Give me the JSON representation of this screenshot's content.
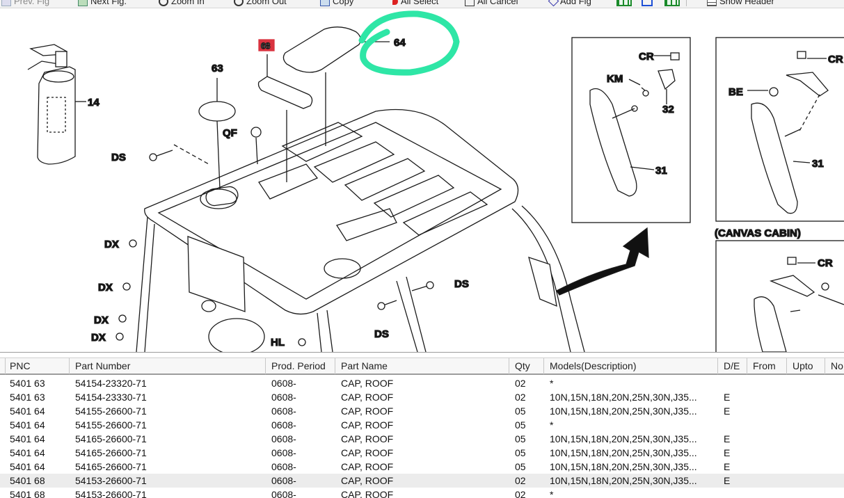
{
  "toolbar": {
    "buttons": [
      {
        "label": "Prev. Fig",
        "icon": "prev-fig-icon"
      },
      {
        "label": "Next Fig.",
        "icon": "next-fig-icon"
      },
      {
        "label": "Zoom In",
        "icon": "zoom-in-icon"
      },
      {
        "label": "Zoom Out",
        "icon": "zoom-out-icon"
      },
      {
        "label": "Copy",
        "icon": "copy-icon"
      },
      {
        "label": "All Select",
        "icon": "all-select-icon"
      },
      {
        "label": "All Cancel",
        "icon": "all-cancel-icon"
      },
      {
        "label": "Add Fig",
        "icon": "add-fig-icon"
      },
      {
        "label": "Show Header",
        "icon": "show-header-icon"
      }
    ]
  },
  "drawing": {
    "callouts": {
      "c14": "14",
      "c63": "63",
      "c68": "68",
      "c64": "64",
      "qf": "QF",
      "ds1": "DS",
      "ds2": "DS",
      "ds3": "DS",
      "dx1": "DX",
      "dx2": "DX",
      "dx3": "DX",
      "dx4": "DX",
      "hl": "HL",
      "cr1": "CR",
      "km": "KM",
      "c32": "32",
      "c31a": "31",
      "cr2": "CR",
      "be": "BE",
      "c31b": "31",
      "cr3": "CR"
    },
    "canvas_cabin_label": "(CANVAS CABIN)",
    "highlight_color": "#2ee6a6",
    "selected_callout_color": "#d9333f"
  },
  "grid": {
    "columns": [
      "PNC",
      "Part Number",
      "Prod. Period",
      "Part Name",
      "Qty",
      "Models(Description)",
      "D/E",
      "From",
      "Upto",
      "No"
    ],
    "rows": [
      {
        "pnc": "5401 63",
        "part_number": "54154-23320-71",
        "period": "0608-",
        "name": "CAP, ROOF",
        "qty": "02",
        "models": "*",
        "de": ""
      },
      {
        "pnc": "5401 63",
        "part_number": "54154-23330-71",
        "period": "0608-",
        "name": "CAP, ROOF",
        "qty": "02",
        "models": "10N,15N,18N,20N,25N,30N,J35...",
        "de": "E"
      },
      {
        "pnc": "5401 64",
        "part_number": "54155-26600-71",
        "period": "0608-",
        "name": "CAP, ROOF",
        "qty": "05",
        "models": "10N,15N,18N,20N,25N,30N,J35...",
        "de": "E"
      },
      {
        "pnc": "5401 64",
        "part_number": "54155-26600-71",
        "period": "0608-",
        "name": "CAP, ROOF",
        "qty": "05",
        "models": "*",
        "de": ""
      },
      {
        "pnc": "5401 64",
        "part_number": "54165-26600-71",
        "period": "0608-",
        "name": "CAP, ROOF",
        "qty": "05",
        "models": "10N,15N,18N,20N,25N,30N,J35...",
        "de": "E"
      },
      {
        "pnc": "5401 64",
        "part_number": "54165-26600-71",
        "period": "0608-",
        "name": "CAP, ROOF",
        "qty": "05",
        "models": "10N,15N,18N,20N,25N,30N,J35...",
        "de": "E"
      },
      {
        "pnc": "5401 64",
        "part_number": "54165-26600-71",
        "period": "0608-",
        "name": "CAP, ROOF",
        "qty": "05",
        "models": "10N,15N,18N,20N,25N,30N,J35...",
        "de": "E"
      },
      {
        "pnc": "5401 68",
        "part_number": "54153-26600-71",
        "period": "0608-",
        "name": "CAP, ROOF",
        "qty": "02",
        "models": "10N,15N,18N,20N,25N,30N,J35...",
        "de": "E",
        "selected": true
      },
      {
        "pnc": "5401 68",
        "part_number": "54153-26600-71",
        "period": "0608-",
        "name": "CAP, ROOF",
        "qty": "02",
        "models": "*",
        "de": ""
      }
    ]
  }
}
